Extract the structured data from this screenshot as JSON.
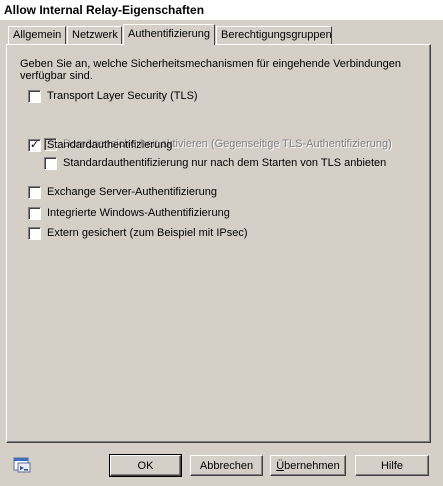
{
  "window": {
    "title": "Allow Internal Relay-Eigenschaften"
  },
  "tabs": [
    {
      "label": "Allgemein",
      "active": false
    },
    {
      "label": "Netzwerk",
      "active": false
    },
    {
      "label": "Authentifizierung",
      "active": true
    },
    {
      "label": "Berechtigungsgruppen",
      "active": false
    }
  ],
  "panel": {
    "intro_line1": "Geben Sie an, welche Sicherheitsmechanismen für eingehende Verbindungen",
    "intro_line2": "verfügbar sind.",
    "options": [
      {
        "label": "Transport Layer Security (TLS)",
        "checked": false,
        "enabled": true
      },
      {
        "label": "Domänensicherheit aktivieren (Gegenseitige TLS-Authentifizierung)",
        "checked": false,
        "enabled": false
      },
      {
        "label": "Standardauthentifizierung",
        "checked": true,
        "enabled": true
      },
      {
        "label": "Standardauthentifizierung nur nach dem Starten von TLS anbieten",
        "checked": false,
        "enabled": true
      },
      {
        "label": "Exchange Server-Authentifizierung",
        "checked": false,
        "enabled": true
      },
      {
        "label": "Integrierte Windows-Authentifizierung",
        "checked": false,
        "enabled": true
      },
      {
        "label": "Extern gesichert (zum Beispiel mit IPsec)",
        "checked": false,
        "enabled": true
      }
    ]
  },
  "buttons": {
    "ok": "OK",
    "cancel": "Abbrechen",
    "apply_first": "Ü",
    "apply_rest": "bernehmen",
    "help": "Hilfe"
  },
  "icons": {
    "bottom_left": "properties-sheet-icon",
    "checkmark": "✓"
  },
  "colors": {
    "face": "#d4d0c8",
    "shadow": "#808080",
    "dark": "#404040",
    "disabled_text": "#808080"
  }
}
